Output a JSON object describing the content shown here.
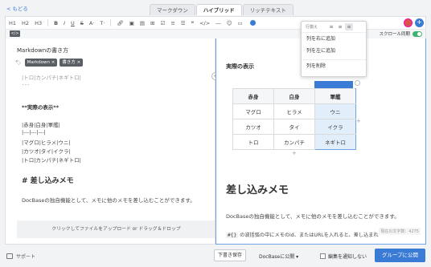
{
  "nav": {
    "back_label": "< もどる"
  },
  "tabs": [
    {
      "label": "マークダウン"
    },
    {
      "label": "ハイブリッド"
    },
    {
      "label": "リッチテキスト"
    }
  ],
  "toolbar": {
    "h1": "H1",
    "h2": "H2",
    "h3": "H3",
    "bold": "B",
    "italic": "I",
    "underline": "U",
    "strike": "S",
    "font": "A·",
    "size": "T·",
    "icons": [
      "link-icon",
      "image-icon",
      "file-icon",
      "table-icon",
      "checklist-icon",
      "ordered-list-icon",
      "bullet-list-icon",
      "quote-icon",
      "code-icon",
      "hr-icon",
      "emoji-icon",
      "template-icon"
    ]
  },
  "subbar": {
    "code_toggle": "</>",
    "sync_label": "スクロール同期"
  },
  "editor": {
    "title": "Markdownの書き方",
    "tags": [
      "Markdown",
      "書き方"
    ],
    "cut_line": "|トロ|カンパチ|ネギトロ|",
    "dots": "･･･",
    "heading_table": "**実際の表示**",
    "table_lines": [
      "|赤身|白身|軍艦|",
      "|---|---|---|",
      "|マグロ|ヒラメ|ウニ|",
      "|カツオ|タイ|イクラ|",
      "|トロ|カンパチ|ネギトロ|"
    ],
    "heading_embed": "# 差し込みメモ",
    "paragraph": "DocBaseの独自機能として、メモに他のメモを差し込むことができます。",
    "upload_label": "クリックしてファイルをアップロード or ドラッグ＆ドロップ"
  },
  "preview": {
    "heading_table": "実際の表示",
    "table": {
      "header": [
        "赤身",
        "白身",
        "軍艦"
      ],
      "rows": [
        [
          "マグロ",
          "ヒラメ",
          "ウニ"
        ],
        [
          "カツオ",
          "タイ",
          "イクラ"
        ],
        [
          "トロ",
          "カンパチ",
          "ネギトロ"
        ]
      ]
    },
    "heading_embed": "差し込みメモ",
    "paragraph1": "DocBaseの独自機能として、メモに他のメモを差し込むことができます。",
    "paragraph2_code": "#{}",
    "paragraph2_rest": " の波括弧の中にメモのid、またはURLを入れると、差し込まれ",
    "char_count": "現在の文字数：4275"
  },
  "context_menu": {
    "align_label": "行揃え",
    "add_right": "列を右に追加",
    "add_left": "列を左に追加",
    "delete": "列を削除"
  },
  "footer": {
    "support": "サポート",
    "draft": "下書き保存",
    "publish_scope": "DocBaseに公開 ▾",
    "notify": "編集を通知しない",
    "group_publish": "グループに公開"
  },
  "colors": {
    "accent": "#3a7bd5",
    "switch_on": "#3cb371",
    "tag_bg": "#5a5f66"
  }
}
